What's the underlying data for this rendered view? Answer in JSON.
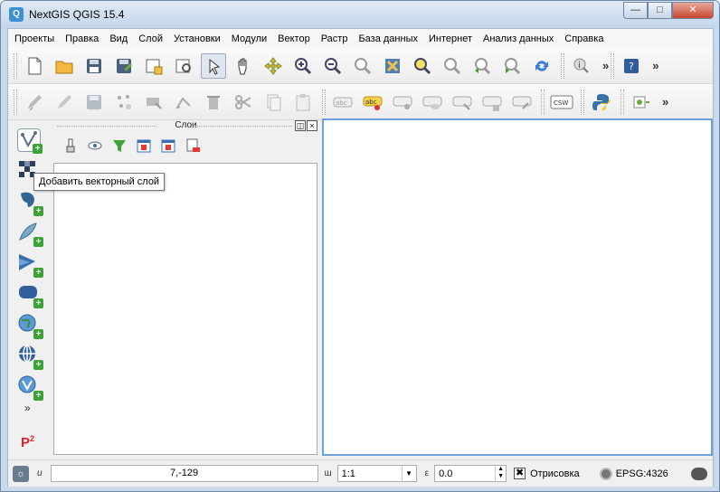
{
  "window": {
    "title": "NextGIS QGIS 15.4",
    "app_icon_letter": "Q"
  },
  "menubar": {
    "items": [
      "Проекты",
      "Правка",
      "Вид",
      "Слой",
      "Установки",
      "Модули",
      "Вектор",
      "Растр",
      "База данных",
      "Интернет",
      "Анализ данных",
      "Справка"
    ]
  },
  "toolbar1": {
    "icons": [
      "new-project",
      "open-project",
      "save-project",
      "save-as",
      "new-print-composer",
      "composer-manager",
      "touch-zoom-pan",
      "pan-map",
      "pan-to-selection",
      "zoom-in",
      "zoom-out",
      "zoom-actual-size",
      "zoom-full",
      "zoom-to-selection",
      "zoom-to-layer",
      "zoom-last",
      "zoom-next",
      "refresh",
      "identify",
      "help"
    ],
    "more": "»"
  },
  "toolbar2": {
    "icons": [
      "current-edits",
      "toggle-editing",
      "save-layer-edits",
      "add-feature",
      "move-feature",
      "node-tool",
      "delete-selected",
      "cut-features",
      "copy-features",
      "paste-features",
      "layer-labeling",
      "label-pin",
      "label-highlight",
      "label-show-hide",
      "label-move",
      "label-rotate",
      "label-change",
      "csw",
      "python",
      "plugin"
    ],
    "labels": {
      "abc": "abc",
      "csw": "CSW"
    },
    "more": "»"
  },
  "left_toolbar": {
    "items": [
      "add-vector-layer",
      "add-raster-layer",
      "add-postgis-layer",
      "add-spatialite-layer",
      "add-mssql-layer",
      "add-db2-layer",
      "add-wms-layer",
      "add-wcs-layer",
      "add-wfs-layer"
    ],
    "chevron": "»",
    "p2_label": "P",
    "p2_sup": "2"
  },
  "layers_panel": {
    "title": "Слои",
    "float_btn": "◫",
    "close_btn": "×"
  },
  "tooltip": {
    "text": "Добавить векторный слой"
  },
  "statusbar": {
    "coord_label": "и",
    "coord_value": "7,-129",
    "scale_label": "ш",
    "scale_value": "1:1",
    "rotation_label": "ε",
    "rotation_value": "0.0",
    "render_label": "Отрисовка",
    "render_checked": "✖",
    "crs_value": "EPSG:4326"
  },
  "colors": {
    "canvas_border": "#6ea1d8",
    "title_bar": "#c4d6ec",
    "close_button": "#c7462f"
  }
}
